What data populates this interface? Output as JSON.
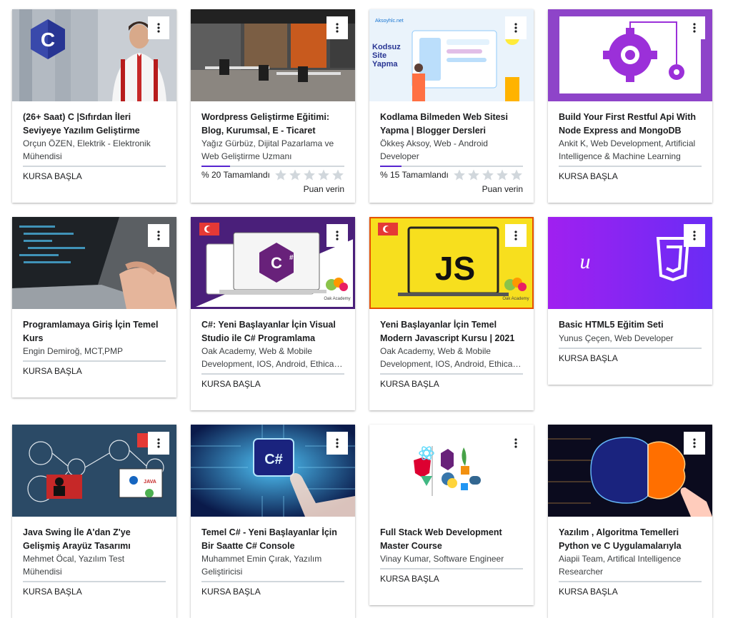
{
  "courses": [
    {
      "title": "(26+ Saat) C |Sıfırdan İleri Seviyeye Yazılım Geliştirme",
      "instructor": "Orçun ÖZEN, Elektrik - Elektronik Mühendisi",
      "action": "KURSA BAŞLA"
    },
    {
      "title": "Wordpress Geliştirme Eğitimi: Blog, Kurumsal, E - Ticaret",
      "instructor": "Yağız Gürbüz, Dijital Pazarlama ve Web Geliştirme Uzmanı",
      "progress_text": "% 20 Tamamlandı",
      "progress": 0.2,
      "rate_label": "Puan verin"
    },
    {
      "title": "Kodlama Bilmeden Web Sitesi Yapma | Blogger Dersleri",
      "instructor": "Ökkeş Aksoy, Web - Android Developer",
      "progress_text": "% 15 Tamamlandı",
      "progress": 0.15,
      "rate_label": "Puan verin",
      "thumb_text": [
        "Kodsuz",
        "Site",
        "Yapma"
      ],
      "thumb_brand": "Aksoyhlc.net"
    },
    {
      "title": "Build Your First Restful Api With Node Express and MongoDB",
      "instructor": "Ankit K, Web Development, Artificial Intelligence & Machine Learning",
      "action": "KURSA BAŞLA"
    },
    {
      "title": "Programlamaya Giriş İçin Temel Kurs",
      "instructor": "Engin Demiroğ, MCT,PMP",
      "action": "KURSA BAŞLA"
    },
    {
      "title": "C#: Yeni Başlayanlar İçin Visual Studio ile C# Programlama",
      "instructor": "Oak Academy, Web & Mobile Development, IOS, Android, Ethical Hacking",
      "action": "KURSA BAŞLA",
      "thumb_brand": "Oak Academy"
    },
    {
      "title": "Yeni Başlayanlar İçin Temel Modern Javascript Kursu | 2021",
      "instructor": "Oak Academy, Web & Mobile Development, IOS, Android, Ethical Hacking",
      "action": "KURSA BAŞLA",
      "thumb_text": "JS",
      "thumb_brand": "Oak Academy"
    },
    {
      "title": "Basic HTML5 Eğitim Seti",
      "instructor": "Yunus Çeçen, Web Developer",
      "action": "KURSA BAŞLA",
      "thumb_text": "u"
    },
    {
      "title": "Java Swing İle A'dan Z'ye Gelişmiş Arayüz Tasarımı",
      "instructor": "Mehmet Öcal, Yazılım Test Mühendisi",
      "action": "KURSA BAŞLA",
      "thumb_text": "JAVA"
    },
    {
      "title": "Temel C# - Yeni Başlayanlar İçin Bir Saatte C# Console",
      "instructor": "Muhammet Emin Çırak, Yazılım Geliştiricisi",
      "action": "KURSA BAŞLA",
      "thumb_text": "C#"
    },
    {
      "title": "Full Stack Web Development Master Course",
      "instructor": "Vinay Kumar, Software Engineer",
      "action": "KURSA BAŞLA"
    },
    {
      "title": "Yazılım , Algoritma Temelleri Python ve C Uygulamalarıyla",
      "instructor": "Aiapii Team, Artifical Intelligence Researcher",
      "action": "KURSA BAŞLA"
    }
  ],
  "colors": {
    "purple": "#5624d0",
    "star": "#d1d7dc",
    "divider": "#d1d7dc"
  }
}
